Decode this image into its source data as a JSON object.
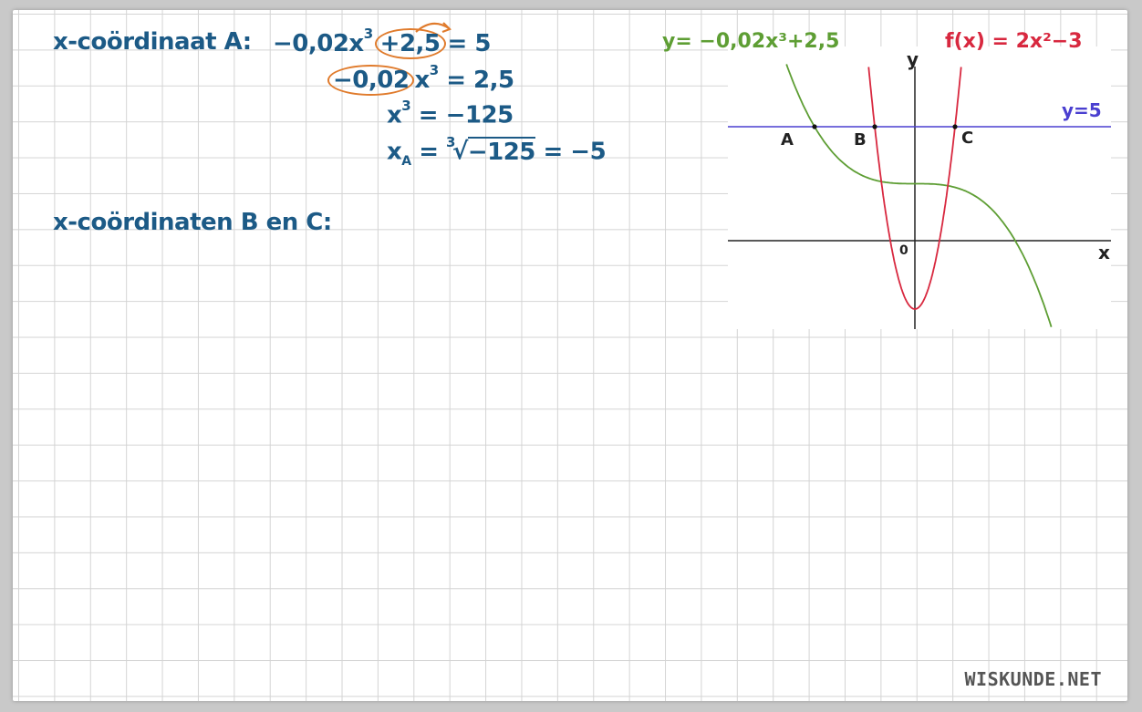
{
  "colors": {
    "ink": "#1c5a86",
    "highlight": "#e07b2c",
    "green_curve": "#5e9e34",
    "red_curve": "#d8283f",
    "blue_line": "#4a3fd0",
    "axis": "#222222",
    "footer": "#555555"
  },
  "work": {
    "line1": {
      "label": "x-coördinaat A:",
      "term1": "−0,02x",
      "exp": "3",
      "circled_term": "+2,5",
      "rhs": "= 5"
    },
    "line2": {
      "circled_term": "−0,02",
      "var": "x",
      "exp": "3",
      "rhs": "= 2,5"
    },
    "line3": {
      "var": "x",
      "exp": "3",
      "rhs": "= −125"
    },
    "line4": {
      "var": "x",
      "sub": "A",
      "eq": "=",
      "root_index": "3",
      "radicand": "−125",
      "rhs": "= −5"
    },
    "line5": {
      "label": "x-coördinaten B en C:"
    }
  },
  "graph": {
    "green_label": "y= −0,02x³+2,5",
    "red_label": "f(x) = 2x²−3",
    "blue_label": "y=5",
    "x_axis_label": "x",
    "y_axis_label": "y",
    "origin_label": "0",
    "point_a": "A",
    "point_b": "B",
    "point_c": "C"
  },
  "chart_data": {
    "type": "line",
    "series": [
      {
        "name": "y= −0,02x³+2,5",
        "color": "#5e9e34"
      },
      {
        "name": "f(x) = 2x²−3",
        "color": "#d8283f"
      },
      {
        "name": "y=5",
        "color": "#4a3fd0"
      }
    ],
    "points": [
      {
        "label": "A",
        "x": -5,
        "y": 5
      },
      {
        "label": "B",
        "y": 5
      },
      {
        "label": "C",
        "y": 5
      }
    ],
    "grid": true
  },
  "footer": {
    "brand": "WISKUNDE.NET"
  }
}
